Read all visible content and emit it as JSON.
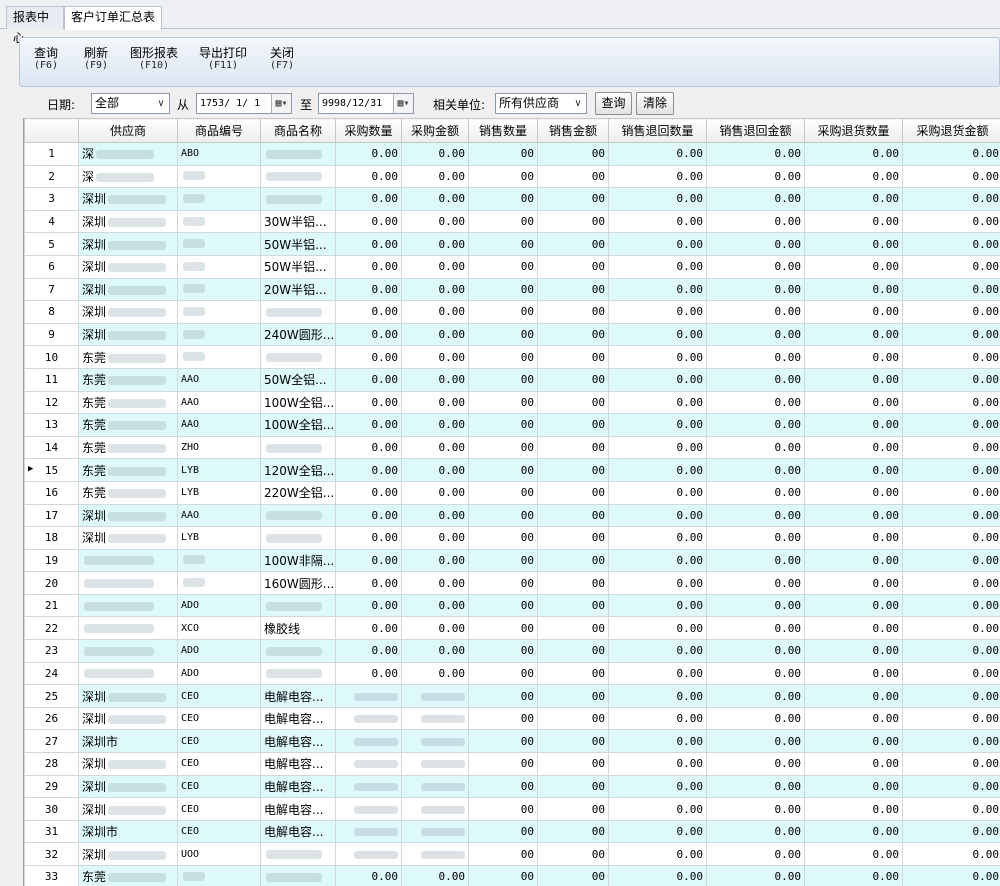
{
  "tabs": [
    "报表中心",
    "客户订单汇总表"
  ],
  "toolbar": [
    {
      "label": "查询",
      "key": "(F6)"
    },
    {
      "label": "刷新",
      "key": "(F9)"
    },
    {
      "label": "图形报表",
      "key": "(F10)"
    },
    {
      "label": "导出打印",
      "key": "(F11)"
    },
    {
      "label": "关闭",
      "key": "(F7)"
    }
  ],
  "filter": {
    "date_label": "日期:",
    "date_range_value": "全部",
    "from_label": "从",
    "from_date": "1753/ 1/ 1",
    "to_label": "至",
    "to_date": "9998/12/31",
    "unit_label": "相关单位:",
    "unit_value": "所有供应商",
    "query_button": "查询",
    "clear_button": "清除"
  },
  "columns": [
    "供应商",
    "商品编号",
    "商品名称",
    "采购数量",
    "采购金额",
    "销售数量",
    "销售金额",
    "销售退回数量",
    "销售退回金额",
    "采购退货数量",
    "采购退货金额"
  ],
  "current_row": 15,
  "rows": [
    {
      "no": "1",
      "supplier": "深",
      "code": "ABO",
      "name": "",
      "pq": "0.00",
      "pa": "0.00",
      "sq": "00",
      "sa": "00",
      "rq": "0.00",
      "ra": "0.00",
      "bq": "0.00",
      "ba": "0.00"
    },
    {
      "no": "2",
      "supplier": "深",
      "code": "",
      "name": "",
      "pq": "0.00",
      "pa": "0.00",
      "sq": "00",
      "sa": "00",
      "rq": "0.00",
      "ra": "0.00",
      "bq": "0.00",
      "ba": "0.00"
    },
    {
      "no": "3",
      "supplier": "深圳",
      "code": "",
      "name": "",
      "pq": "0.00",
      "pa": "0.00",
      "sq": "00",
      "sa": "00",
      "rq": "0.00",
      "ra": "0.00",
      "bq": "0.00",
      "ba": "0.00"
    },
    {
      "no": "4",
      "supplier": "深圳",
      "code": "",
      "name": "30W半铝...",
      "pq": "0.00",
      "pa": "0.00",
      "sq": "00",
      "sa": "00",
      "rq": "0.00",
      "ra": "0.00",
      "bq": "0.00",
      "ba": "0.00"
    },
    {
      "no": "5",
      "supplier": "深圳",
      "code": "",
      "name": "50W半铝...",
      "pq": "0.00",
      "pa": "0.00",
      "sq": "00",
      "sa": "00",
      "rq": "0.00",
      "ra": "0.00",
      "bq": "0.00",
      "ba": "0.00"
    },
    {
      "no": "6",
      "supplier": "深圳",
      "code": "",
      "name": "50W半铝...",
      "pq": "0.00",
      "pa": "0.00",
      "sq": "00",
      "sa": "00",
      "rq": "0.00",
      "ra": "0.00",
      "bq": "0.00",
      "ba": "0.00"
    },
    {
      "no": "7",
      "supplier": "深圳",
      "code": "",
      "name": "20W半铝...",
      "pq": "0.00",
      "pa": "0.00",
      "sq": "00",
      "sa": "00",
      "rq": "0.00",
      "ra": "0.00",
      "bq": "0.00",
      "ba": "0.00"
    },
    {
      "no": "8",
      "supplier": "深圳",
      "code": "",
      "name": "",
      "pq": "0.00",
      "pa": "0.00",
      "sq": "00",
      "sa": "00",
      "rq": "0.00",
      "ra": "0.00",
      "bq": "0.00",
      "ba": "0.00"
    },
    {
      "no": "9",
      "supplier": "深圳",
      "code": "",
      "name": "240W圆形...",
      "pq": "0.00",
      "pa": "0.00",
      "sq": "00",
      "sa": "00",
      "rq": "0.00",
      "ra": "0.00",
      "bq": "0.00",
      "ba": "0.00"
    },
    {
      "no": "10",
      "supplier": "东莞",
      "code": "",
      "name": "",
      "pq": "0.00",
      "pa": "0.00",
      "sq": "00",
      "sa": "00",
      "rq": "0.00",
      "ra": "0.00",
      "bq": "0.00",
      "ba": "0.00"
    },
    {
      "no": "11",
      "supplier": "东莞",
      "code": "AAO",
      "name": "50W全铝...",
      "pq": "0.00",
      "pa": "0.00",
      "sq": "00",
      "sa": "00",
      "rq": "0.00",
      "ra": "0.00",
      "bq": "0.00",
      "ba": "0.00"
    },
    {
      "no": "12",
      "supplier": "东莞",
      "code": "AAO",
      "name": "100W全铝...",
      "pq": "0.00",
      "pa": "0.00",
      "sq": "00",
      "sa": "00",
      "rq": "0.00",
      "ra": "0.00",
      "bq": "0.00",
      "ba": "0.00"
    },
    {
      "no": "13",
      "supplier": "东莞",
      "code": "AAO",
      "name": "100W全铝...",
      "pq": "0.00",
      "pa": "0.00",
      "sq": "00",
      "sa": "00",
      "rq": "0.00",
      "ra": "0.00",
      "bq": "0.00",
      "ba": "0.00"
    },
    {
      "no": "14",
      "supplier": "东莞",
      "code": "ZHO",
      "name": "",
      "pq": "0.00",
      "pa": "0.00",
      "sq": "00",
      "sa": "00",
      "rq": "0.00",
      "ra": "0.00",
      "bq": "0.00",
      "ba": "0.00"
    },
    {
      "no": "15",
      "supplier": "东莞",
      "code": "LYB",
      "name": "120W全铝...",
      "pq": "0.00",
      "pa": "0.00",
      "sq": "00",
      "sa": "00",
      "rq": "0.00",
      "ra": "0.00",
      "bq": "0.00",
      "ba": "0.00"
    },
    {
      "no": "16",
      "supplier": "东莞",
      "code": "LYB",
      "name": "220W全铝...",
      "pq": "0.00",
      "pa": "0.00",
      "sq": "00",
      "sa": "00",
      "rq": "0.00",
      "ra": "0.00",
      "bq": "0.00",
      "ba": "0.00"
    },
    {
      "no": "17",
      "supplier": "深圳",
      "code": "AAO",
      "name": "",
      "pq": "0.00",
      "pa": "0.00",
      "sq": "00",
      "sa": "00",
      "rq": "0.00",
      "ra": "0.00",
      "bq": "0.00",
      "ba": "0.00"
    },
    {
      "no": "18",
      "supplier": "深圳",
      "code": "LYB",
      "name": "",
      "pq": "0.00",
      "pa": "0.00",
      "sq": "00",
      "sa": "00",
      "rq": "0.00",
      "ra": "0.00",
      "bq": "0.00",
      "ba": "0.00"
    },
    {
      "no": "19",
      "supplier": "",
      "code": "",
      "name": "100W非隔...",
      "pq": "0.00",
      "pa": "0.00",
      "sq": "00",
      "sa": "00",
      "rq": "0.00",
      "ra": "0.00",
      "bq": "0.00",
      "ba": "0.00"
    },
    {
      "no": "20",
      "supplier": "",
      "code": "",
      "name": "160W圆形...",
      "pq": "0.00",
      "pa": "0.00",
      "sq": "00",
      "sa": "00",
      "rq": "0.00",
      "ra": "0.00",
      "bq": "0.00",
      "ba": "0.00"
    },
    {
      "no": "21",
      "supplier": "",
      "code": "ADO",
      "name": "",
      "pq": "0.00",
      "pa": "0.00",
      "sq": "00",
      "sa": "00",
      "rq": "0.00",
      "ra": "0.00",
      "bq": "0.00",
      "ba": "0.00"
    },
    {
      "no": "22",
      "supplier": "",
      "code": "XCO",
      "name": "橡胶线",
      "pq": "0.00",
      "pa": "0.00",
      "sq": "00",
      "sa": "00",
      "rq": "0.00",
      "ra": "0.00",
      "bq": "0.00",
      "ba": "0.00"
    },
    {
      "no": "23",
      "supplier": "",
      "code": "ADO",
      "name": "",
      "pq": "0.00",
      "pa": "0.00",
      "sq": "00",
      "sa": "00",
      "rq": "0.00",
      "ra": "0.00",
      "bq": "0.00",
      "ba": "0.00"
    },
    {
      "no": "24",
      "supplier": "",
      "code": "ADO",
      "name": "",
      "pq": "0.00",
      "pa": "0.00",
      "sq": "00",
      "sa": "00",
      "rq": "0.00",
      "ra": "0.00",
      "bq": "0.00",
      "ba": "0.00"
    },
    {
      "no": "25",
      "supplier": "深圳",
      "code": "CEO",
      "name": "电解电容...",
      "pq": "",
      "pa": "",
      "sq": "00",
      "sa": "00",
      "rq": "0.00",
      "ra": "0.00",
      "bq": "0.00",
      "ba": "0.00"
    },
    {
      "no": "26",
      "supplier": "深圳",
      "code": "CEO",
      "name": "电解电容...",
      "pq": "",
      "pa": "",
      "sq": "00",
      "sa": "00",
      "rq": "0.00",
      "ra": "0.00",
      "bq": "0.00",
      "ba": "0.00"
    },
    {
      "no": "27",
      "supplier": "深圳市",
      "code": "CEO",
      "name": "电解电容...",
      "pq": "",
      "pa": "",
      "sq": "00",
      "sa": "00",
      "rq": "0.00",
      "ra": "0.00",
      "bq": "0.00",
      "ba": "0.00"
    },
    {
      "no": "28",
      "supplier": "深圳",
      "code": "CEO",
      "name": "电解电容...",
      "pq": "",
      "pa": "",
      "sq": "00",
      "sa": "00",
      "rq": "0.00",
      "ra": "0.00",
      "bq": "0.00",
      "ba": "0.00"
    },
    {
      "no": "29",
      "supplier": "深圳",
      "code": "CEO",
      "name": "电解电容...",
      "pq": "",
      "pa": "",
      "sq": "00",
      "sa": "00",
      "rq": "0.00",
      "ra": "0.00",
      "bq": "0.00",
      "ba": "0.00"
    },
    {
      "no": "30",
      "supplier": "深圳",
      "code": "CEO",
      "name": "电解电容...",
      "pq": "",
      "pa": "",
      "sq": "00",
      "sa": "00",
      "rq": "0.00",
      "ra": "0.00",
      "bq": "0.00",
      "ba": "0.00"
    },
    {
      "no": "31",
      "supplier": "深圳市",
      "code": "CEO",
      "name": "电解电容...",
      "pq": "",
      "pa": "",
      "sq": "00",
      "sa": "00",
      "rq": "0.00",
      "ra": "0.00",
      "bq": "0.00",
      "ba": "0.00"
    },
    {
      "no": "32",
      "supplier": "深圳",
      "code": "UOO",
      "name": "",
      "pq": "",
      "pa": "",
      "sq": "00",
      "sa": "00",
      "rq": "0.00",
      "ra": "0.00",
      "bq": "0.00",
      "ba": "0.00"
    },
    {
      "no": "33",
      "supplier": "东莞",
      "code": "",
      "name": "",
      "pq": "0.00",
      "pa": "0.00",
      "sq": "00",
      "sa": "00",
      "rq": "0.00",
      "ra": "0.00",
      "bq": "0.00",
      "ba": "0.00"
    }
  ]
}
